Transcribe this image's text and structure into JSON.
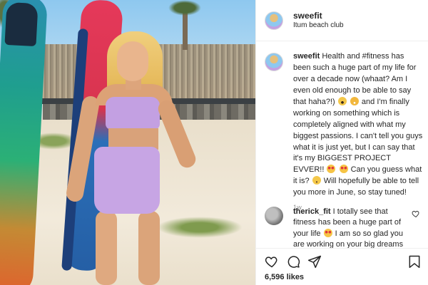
{
  "post": {
    "username": "sweefit",
    "location": "Itum beach club",
    "caption_username": "sweefit",
    "caption_part1": "Health and #fitness has been such a huge part of my life for over a decade now (whaat? Am I even old enough to be able to say that haha?!)",
    "caption_part2": "and I'm finally working on something which is completely aligned with what my biggest passions. I can't tell you guys what it is just yet, but I can say that it's my BIGGEST PROJECT EVVER!!",
    "caption_part3": "Can you guess what it is?",
    "caption_part4": "Will hopefully be able to tell you more in June, so stay tuned!",
    "time_ago": "1w",
    "comment_username": "therick_fit",
    "comment_part1": "I totally see that fitness has been a huge part of your life",
    "comment_part2": "I am so so glad you are working on your big dreams",
    "likes": "6,596 likes",
    "icons": [
      "heart-icon",
      "comment-icon",
      "share-icon",
      "bookmark-icon"
    ]
  }
}
